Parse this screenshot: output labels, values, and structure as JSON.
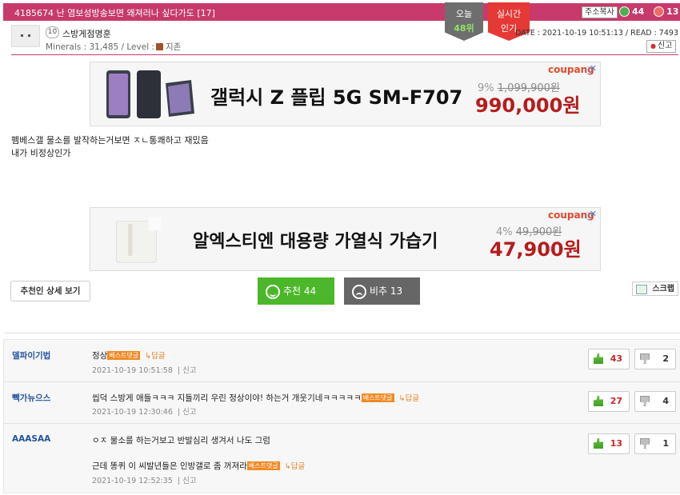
{
  "post": {
    "title": "4185674 난 염보성방송보면 왜져러나 싶다가도 [17]",
    "today_badge": {
      "line1": "오늘",
      "line2": "48위"
    },
    "live_badge": {
      "line1": "실시간",
      "line2": "인기"
    },
    "copy_address": "주소복사",
    "votes_up": "44",
    "votes_down": "13",
    "author": {
      "level": "10",
      "nickname": "스방게점명훈",
      "minerals_label": "Minerals : 31,485 / Level :",
      "rank": "지존"
    },
    "date_label": "DATE : 2021-10-19 10:51:13 / READ : 7493",
    "report": "신고",
    "body_lines": [
      "펨베스갤 물소를 발작하는거보면 ㅈㄴ통쾌하고 재밌음",
      "내가 비정상인가"
    ]
  },
  "ads": [
    {
      "brand": "coupang",
      "title": "갤럭시 Z 플립 5G SM-F707",
      "discount": "9%",
      "original_price": "1,099,900원",
      "price": "990,000원"
    },
    {
      "brand": "coupang",
      "title": "알엑스티엔 대용량 가열식 가습기",
      "discount": "4%",
      "original_price": "49,900원",
      "price": "47,900원"
    }
  ],
  "actions": {
    "detail": "추천인 상세 보기",
    "recommend": "추천 44",
    "oppose": "비추 13",
    "scrap": "스크랩"
  },
  "comments": [
    {
      "author": "델파이기법",
      "lines": [
        "정상"
      ],
      "best": "베스트댓글",
      "reply": "↳답글",
      "date": "2021-10-19 10:51:58",
      "report": "신고",
      "up": "43",
      "down": "2"
    },
    {
      "author": "빽가뉴으스",
      "lines": [
        "씹덕 스방게 애들ㅋㅋㅋ 지들끼리 우린 정상이야! 하는거 개웃기네ㅋㅋㅋㅋㅋ"
      ],
      "best": "베스트댓글",
      "reply": "↳답글",
      "date": "2021-10-19 12:30:46",
      "report": "신고",
      "up": "27",
      "down": "4"
    },
    {
      "author": "AAASAA",
      "lines": [
        "ㅇㅈ 물소를 하는거보고 반발심리 생겨서 나도 그럼",
        "근데 똥퀴 이 씨발년들은 인방갤로 좀 꺼져라"
      ],
      "best": "베스트댓글",
      "reply": "↳답글",
      "date": "2021-10-19 12:52:35",
      "report": "신고",
      "up": "13",
      "down": "1"
    }
  ],
  "colors": {
    "title_bar": "#c73a6b",
    "recommend": "#4cb72a",
    "oppose": "#666666",
    "price": "#b71c1c",
    "best_badge": "#f08a24"
  }
}
